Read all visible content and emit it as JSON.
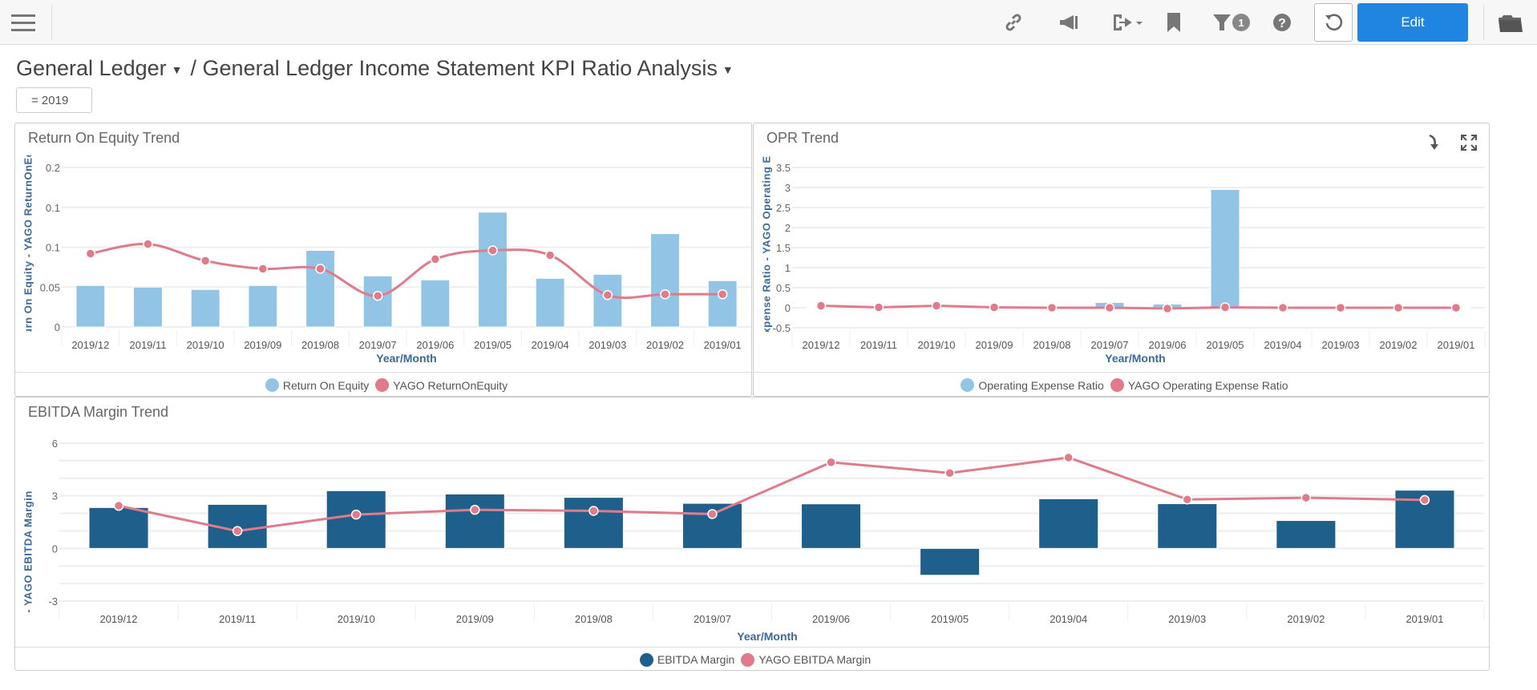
{
  "toolbar": {
    "icons": [
      "menu-icon",
      "link-icon",
      "megaphone-icon",
      "export-icon",
      "bookmark-icon",
      "filter-icon",
      "help-icon",
      "refresh-icon",
      "folder-icon"
    ],
    "filter_count": "1",
    "edit_label": "Edit"
  },
  "breadcrumb": {
    "parent": "General Ledger",
    "separator": "/",
    "current": "General Ledger Income Statement KPI Ratio Analysis"
  },
  "filter_chip": "= 2019",
  "colors": {
    "accent": "#2085e0",
    "bar_light": "#92c4e6",
    "bar_dark": "#1f5f8b",
    "line": "#e07b8b",
    "axis_title": "#3a6a9a"
  },
  "chart_data": [
    {
      "title": "Return On Equity Trend",
      "type": "bar+line",
      "xlabel": "Year/Month",
      "ylabel": "Return On Equity  -  YAGO ReturnOnEquity",
      "categories": [
        "2019/12",
        "2019/11",
        "2019/10",
        "2019/09",
        "2019/08",
        "2019/07",
        "2019/06",
        "2019/05",
        "2019/04",
        "2019/03",
        "2019/02",
        "2019/01"
      ],
      "ylim": [
        0,
        0.2
      ],
      "y_ticks": [
        0,
        0.05,
        0.1,
        0.15,
        0.2
      ],
      "y_tick_labels": [
        "0",
        "0.05",
        "0.1",
        "0.1",
        "0.2"
      ],
      "smooth": true,
      "legend": "bottom",
      "series": [
        {
          "name": "Return On Equity",
          "type": "bar",
          "color": "#92c4e6",
          "values": [
            0.052,
            0.05,
            0.047,
            0.052,
            0.096,
            0.064,
            0.059,
            0.144,
            0.061,
            0.066,
            0.117,
            0.058
          ]
        },
        {
          "name": "YAGO ReturnOnEquity",
          "type": "line",
          "color": "#e07b8b",
          "values": [
            0.092,
            0.104,
            0.083,
            0.073,
            0.073,
            0.039,
            0.085,
            0.096,
            0.09,
            0.04,
            0.041,
            0.041
          ]
        }
      ]
    },
    {
      "title": "OPR Trend",
      "type": "bar+line",
      "xlabel": "Year/Month",
      "ylabel": "Operating Expense Ratio  -  YAGO Operating Expense Ratio",
      "categories": [
        "2019/12",
        "2019/11",
        "2019/10",
        "2019/09",
        "2019/08",
        "2019/07",
        "2019/06",
        "2019/05",
        "2019/04",
        "2019/03",
        "2019/02",
        "2019/01"
      ],
      "ylim": [
        -0.5,
        3.5
      ],
      "y_ticks": [
        -0.5,
        0,
        0.5,
        1,
        1.5,
        2,
        2.5,
        3,
        3.5
      ],
      "y_tick_labels": [
        "-0.5",
        "0",
        "0.5",
        "1",
        "1.5",
        "2",
        "2.5",
        "3",
        "3.5"
      ],
      "smooth": false,
      "legend": "bottom",
      "series": [
        {
          "name": "Operating Expense Ratio",
          "type": "bar",
          "color": "#92c4e6",
          "values": [
            0.01,
            0,
            0,
            0,
            0,
            0.13,
            0.09,
            2.95,
            0,
            0,
            0,
            0.01
          ]
        },
        {
          "name": "YAGO Operating Expense Ratio",
          "type": "line",
          "color": "#e07b8b",
          "values": [
            0.05,
            0.01,
            0.05,
            0.01,
            0,
            0,
            -0.02,
            0.01,
            0,
            0,
            0,
            0
          ]
        }
      ]
    },
    {
      "title": "EBITDA Margin Trend",
      "type": "bar+line",
      "xlabel": "Year/Month",
      "ylabel": "EBITDA Margin  -  YAGO EBITDA Margin",
      "categories": [
        "2019/12",
        "2019/11",
        "2019/10",
        "2019/09",
        "2019/08",
        "2019/07",
        "2019/06",
        "2019/05",
        "2019/04",
        "2019/03",
        "2019/02",
        "2019/01"
      ],
      "ylim": [
        -3,
        6
      ],
      "y_ticks": [
        -3,
        -2,
        -1,
        0,
        1,
        2,
        3,
        4,
        5,
        6
      ],
      "y_tick_labels": [
        "-3",
        "",
        "",
        "0",
        "",
        "",
        "3",
        "",
        "",
        "6"
      ],
      "smooth": false,
      "legend": "bottom",
      "series": [
        {
          "name": "EBITDA Margin",
          "type": "bar",
          "color": "#1f5f8b",
          "values": [
            2.33,
            2.51,
            3.29,
            3.1,
            2.91,
            2.57,
            2.54,
            -1.53,
            2.83,
            2.55,
            1.59,
            3.32
          ]
        },
        {
          "name": "YAGO EBITDA Margin",
          "type": "line",
          "color": "#e07b8b",
          "values": [
            2.43,
            0.99,
            1.93,
            2.2,
            2.14,
            1.96,
            4.91,
            4.3,
            5.18,
            2.79,
            2.89,
            2.76
          ]
        }
      ]
    }
  ]
}
